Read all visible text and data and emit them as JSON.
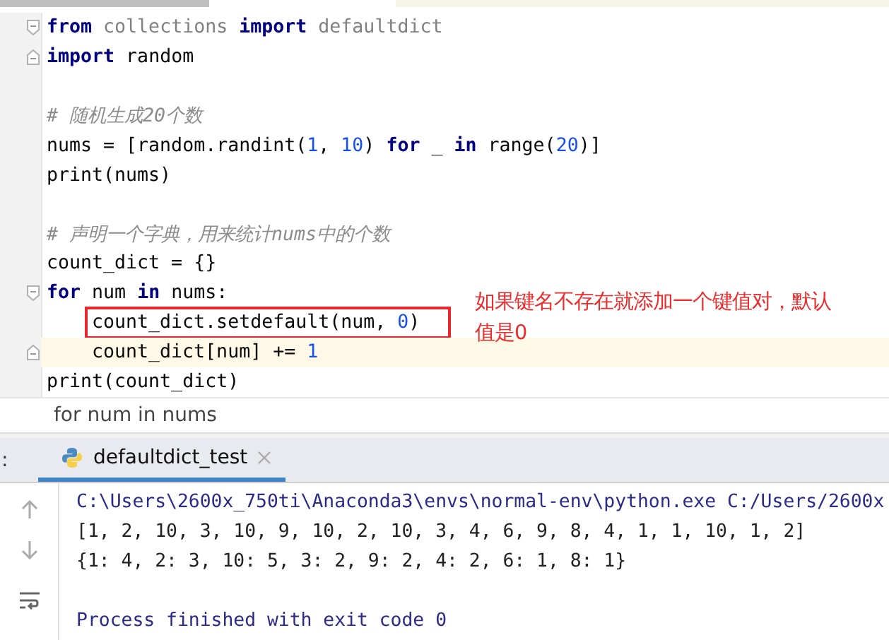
{
  "editor": {
    "lines": [
      {
        "fold_open": true,
        "tokens": [
          {
            "kind": "kw",
            "text": "from"
          },
          {
            "kind": "unused",
            "text": " collections "
          },
          {
            "kind": "kw",
            "text": "import"
          },
          {
            "kind": "unused",
            "text": " defaultdict"
          }
        ]
      },
      {
        "fold_close": true,
        "tokens": [
          {
            "kind": "kw",
            "text": "import"
          },
          {
            "kind": "id",
            "text": " random"
          }
        ]
      },
      {
        "space_before": true,
        "tokens": [
          {
            "kind": "comment",
            "text": "# 随机生成20个数"
          }
        ]
      },
      {
        "tokens": [
          {
            "kind": "id",
            "text": "nums = [random.randint("
          },
          {
            "kind": "num",
            "text": "1"
          },
          {
            "kind": "id",
            "text": ", "
          },
          {
            "kind": "num",
            "text": "10"
          },
          {
            "kind": "id",
            "text": ") "
          },
          {
            "kind": "kw",
            "text": "for"
          },
          {
            "kind": "id",
            "text": " _ "
          },
          {
            "kind": "kw",
            "text": "in"
          },
          {
            "kind": "id",
            "text": " range("
          },
          {
            "kind": "num",
            "text": "20"
          },
          {
            "kind": "id",
            "text": ")]"
          }
        ]
      },
      {
        "tokens": [
          {
            "kind": "id",
            "text": "print(nums)"
          }
        ]
      },
      {
        "space_before": true,
        "tokens": [
          {
            "kind": "comment",
            "text": "# 声明一个字典，用来统计nums中的个数"
          }
        ]
      },
      {
        "tokens": [
          {
            "kind": "id",
            "text": "count_dict = {}"
          }
        ]
      },
      {
        "fold_open": true,
        "tokens": [
          {
            "kind": "kw",
            "text": "for"
          },
          {
            "kind": "id",
            "text": " num "
          },
          {
            "kind": "kw",
            "text": "in"
          },
          {
            "kind": "id",
            "text": " nums:"
          }
        ]
      },
      {
        "indent": true,
        "boxed": true,
        "tokens": [
          {
            "kind": "id",
            "text": "count_dict.setdefault(num, "
          },
          {
            "kind": "num",
            "text": "0"
          },
          {
            "kind": "id",
            "text": ")"
          }
        ]
      },
      {
        "indent": true,
        "current": true,
        "fold_close": true,
        "tokens": [
          {
            "kind": "id",
            "text": "count_dict[num] += "
          },
          {
            "kind": "num",
            "text": "1"
          }
        ]
      },
      {
        "tokens": [
          {
            "kind": "id",
            "text": "print(count_dict)"
          }
        ]
      }
    ],
    "annotation": "如果键名不存在就添加一个键值对，默认值是0"
  },
  "breadcrumb": "for num in nums",
  "run_panel": {
    "label": ":",
    "tab": "defaultdict_test",
    "output": [
      {
        "kind": "command",
        "text": "C:\\Users\\2600x_750ti\\Anaconda3\\envs\\normal-env\\python.exe C:/Users/2600x"
      },
      {
        "kind": "out",
        "text": "[1, 2, 10, 3, 10, 9, 10, 2, 10, 3, 4, 6, 9, 8, 4, 1, 1, 10, 1, 2]"
      },
      {
        "kind": "out",
        "text": "{1: 4, 2: 3, 10: 5, 3: 2, 9: 2, 4: 2, 6: 1, 8: 1}"
      },
      {
        "kind": "status",
        "space_before": true,
        "text": "Process finished with exit code 0"
      }
    ]
  }
}
